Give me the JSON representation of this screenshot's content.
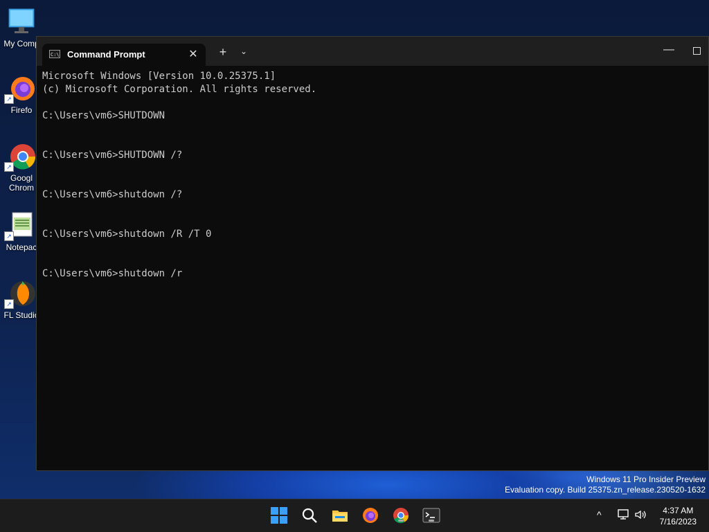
{
  "desktop": {
    "icons": [
      {
        "label": "My Comp",
        "icon": "monitor-icon"
      },
      {
        "label": "Firefo",
        "icon": "firefox-icon"
      },
      {
        "label": "Googl",
        "label2": "Chrom",
        "icon": "chrome-icon"
      },
      {
        "label": "Notepac",
        "icon": "notepad-icon"
      },
      {
        "label": "FL Studio",
        "icon": "fl-studio-icon"
      }
    ]
  },
  "window": {
    "tab_title": "Command Prompt",
    "tab_close": "✕",
    "new_tab": "+",
    "dropdown": "⌄",
    "minimize": "—"
  },
  "console": {
    "lines": [
      "Microsoft Windows [Version 10.0.25375.1]",
      "(c) Microsoft Corporation. All rights reserved.",
      "",
      "C:\\Users\\vm6>SHUTDOWN",
      "",
      "",
      "C:\\Users\\vm6>SHUTDOWN /?",
      "",
      "",
      "C:\\Users\\vm6>shutdown /?",
      "",
      "",
      "C:\\Users\\vm6>shutdown /R /T 0",
      "",
      "",
      "C:\\Users\\vm6>shutdown /r"
    ]
  },
  "watermark": {
    "line1": "Windows 11 Pro Insider Preview",
    "line2": "Evaluation copy. Build 25375.zn_release.230520-1632"
  },
  "taskbar": {
    "apps": [
      "start-icon",
      "search-icon",
      "file-explorer-icon",
      "firefox-icon",
      "chrome-icon",
      "terminal-icon"
    ],
    "tray_chevron": "^",
    "time": "4:37 AM",
    "date": "7/16/2023"
  }
}
